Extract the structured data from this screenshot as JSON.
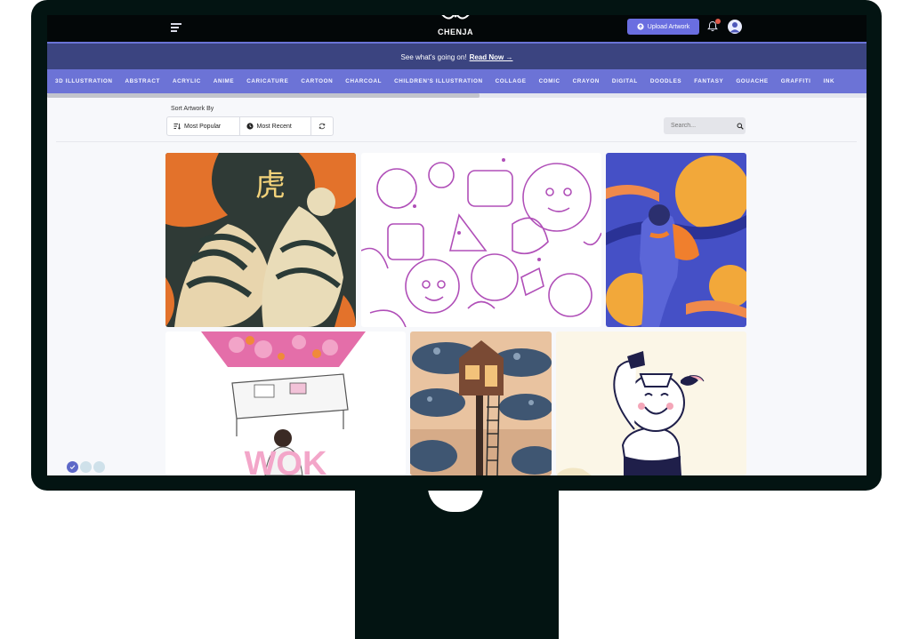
{
  "brand": {
    "name": "CHENJA"
  },
  "topnav": {
    "upload_label": "Upload Artwork"
  },
  "announcement": {
    "text": "See what's going on!",
    "link": "Read Now →"
  },
  "categories": [
    "3D ILLUSTRATION",
    "ABSTRACT",
    "ACRYLIC",
    "ANIME",
    "CARICATURE",
    "CARTOON",
    "CHARCOAL",
    "CHILDREN'S ILLUSTRATION",
    "COLLAGE",
    "COMIC",
    "CRAYON",
    "DIGITAL",
    "DOODLES",
    "FANTASY",
    "GOUACHE",
    "GRAFFITI",
    "INK"
  ],
  "sort": {
    "label": "Sort Artwork By",
    "options": [
      "Most Popular",
      "Most Recent"
    ]
  },
  "search": {
    "placeholder": "Search..."
  },
  "gallery": {
    "tiles": [
      {
        "name": "tiger-artwork",
        "glyph": "虎"
      },
      {
        "name": "doodle-artwork"
      },
      {
        "name": "wind-walker-artwork"
      },
      {
        "name": "work-desk-artwork",
        "text": "WOK"
      },
      {
        "name": "treehouse-artwork"
      },
      {
        "name": "coffee-head-artwork"
      }
    ]
  },
  "colors": {
    "bezel": "#031412",
    "accent": "#6c73d6",
    "announcement_bg": "#3b4480",
    "upload_button": "#6a6ee0"
  },
  "icons": [
    "menu-icon",
    "upload-icon",
    "bell-icon",
    "avatar-icon",
    "sort-icon",
    "clock-icon",
    "refresh-icon",
    "search-icon",
    "check-icon"
  ]
}
